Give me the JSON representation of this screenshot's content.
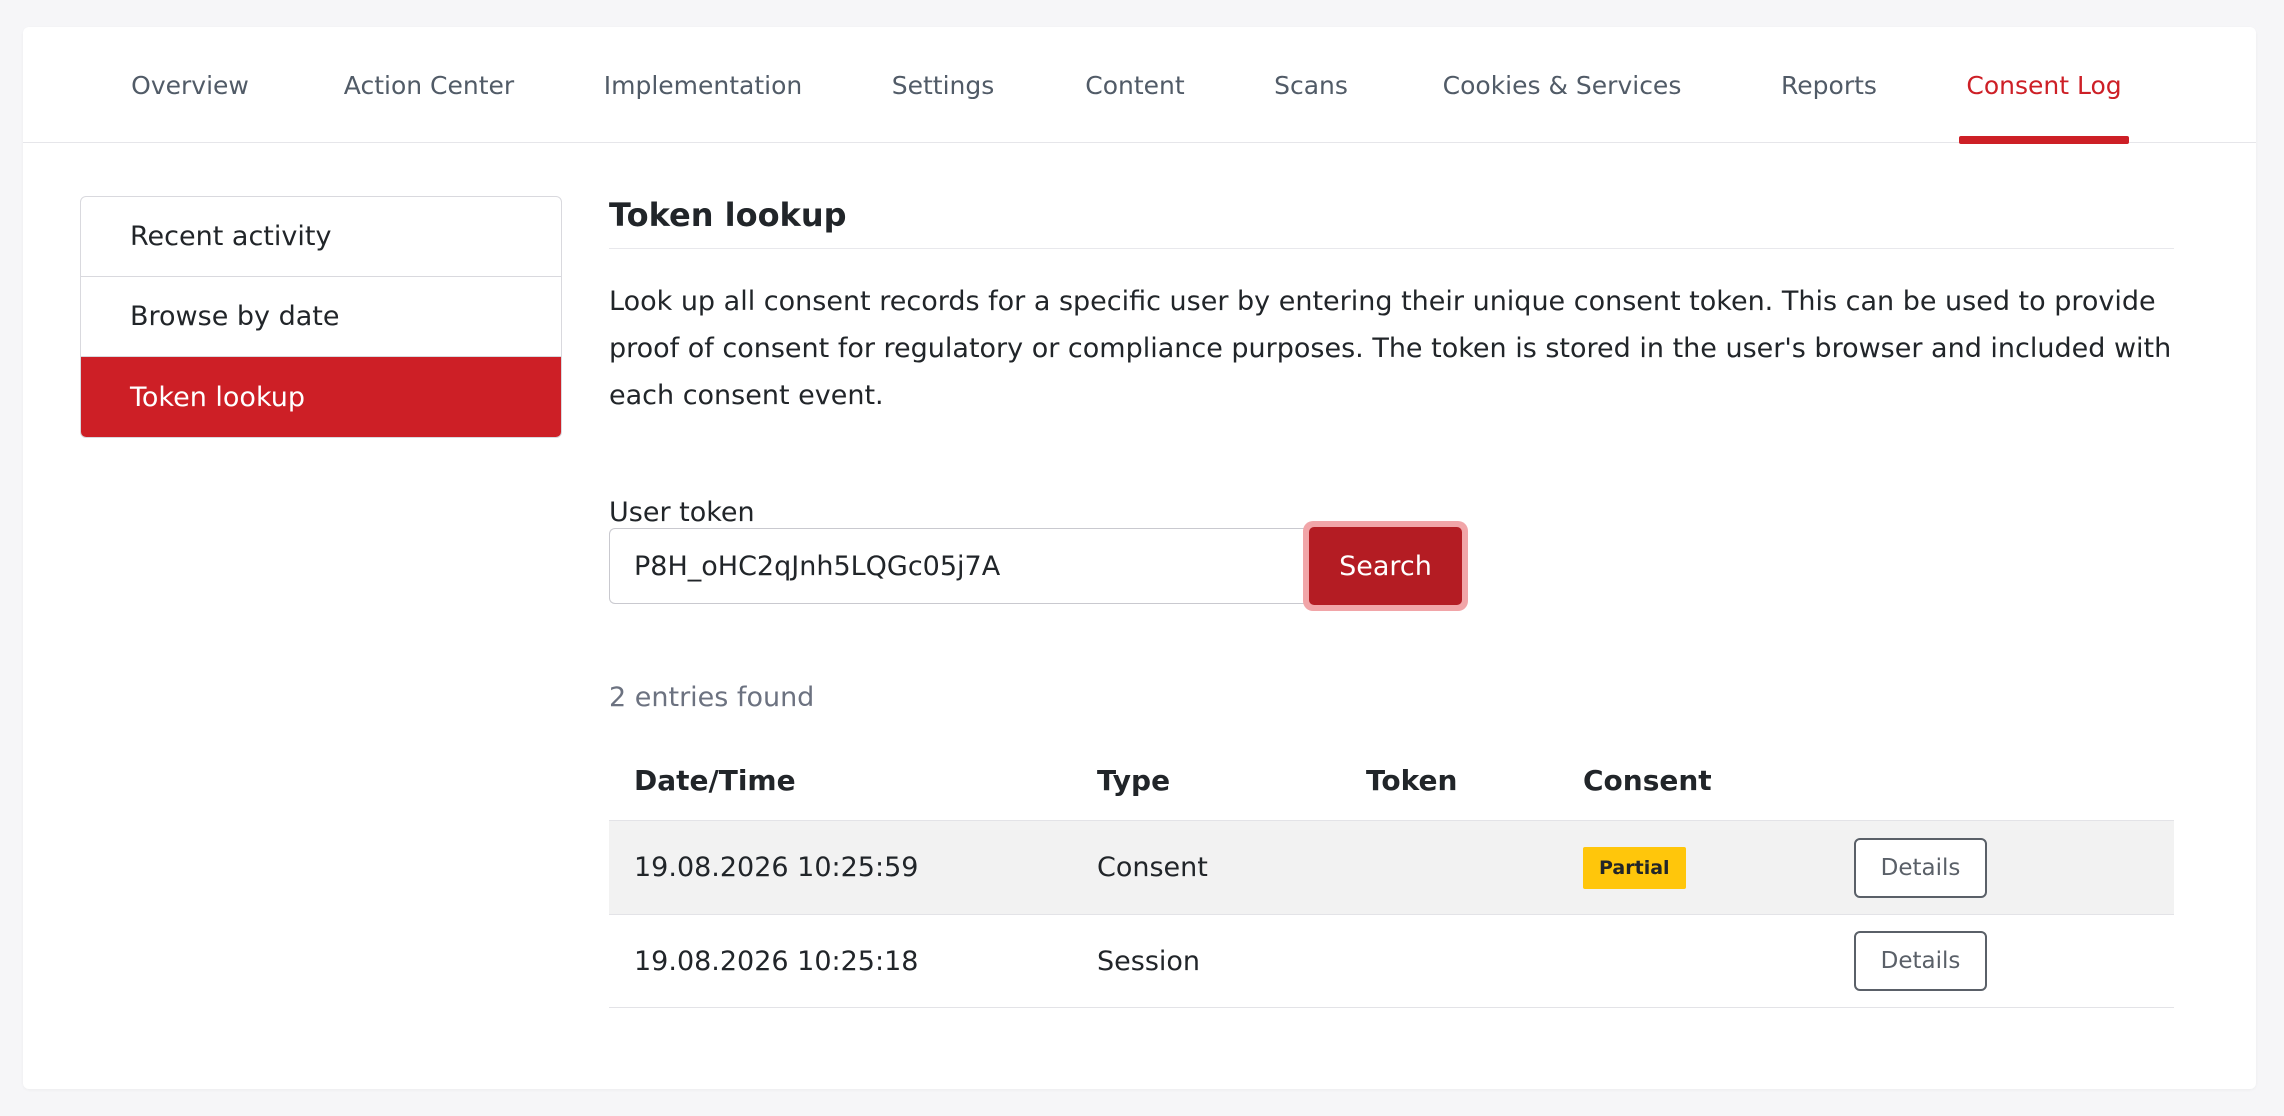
{
  "topnav": {
    "tabs": [
      {
        "label": "Overview"
      },
      {
        "label": "Action Center"
      },
      {
        "label": "Implementation"
      },
      {
        "label": "Settings"
      },
      {
        "label": "Content"
      },
      {
        "label": "Scans"
      },
      {
        "label": "Cookies & Services"
      },
      {
        "label": "Reports"
      },
      {
        "label": "Consent Log"
      }
    ],
    "active": "Consent Log"
  },
  "sidebar": {
    "items": [
      {
        "label": "Recent activity"
      },
      {
        "label": "Browse by date"
      },
      {
        "label": "Token lookup"
      }
    ],
    "active": "Token lookup"
  },
  "main": {
    "title": "Token lookup",
    "description": "Look up all consent records for a specific user by entering their unique consent token. This can be used to provide proof of consent for regulatory or compliance purposes. The token is stored in the user's browser and included with each consent event.",
    "token_label": "User token",
    "token_value": "P8H_oHC2qJnh5LQGc05j7A",
    "search_label": "Search",
    "results_count": "2 entries found"
  },
  "table": {
    "headers": [
      "Date/Time",
      "Type",
      "Token",
      "Consent",
      ""
    ],
    "rows": [
      {
        "datetime": "19.08.2026 10:25:59",
        "type": "Consent",
        "token": "",
        "consent": "Partial",
        "action": "Details"
      },
      {
        "datetime": "19.08.2026 10:25:18",
        "type": "Session",
        "token": "",
        "consent": "",
        "action": "Details"
      }
    ]
  },
  "colors": {
    "accent": "#cd1f26",
    "search_button": "#b41c23",
    "badge_partial": "#ffc60b"
  }
}
